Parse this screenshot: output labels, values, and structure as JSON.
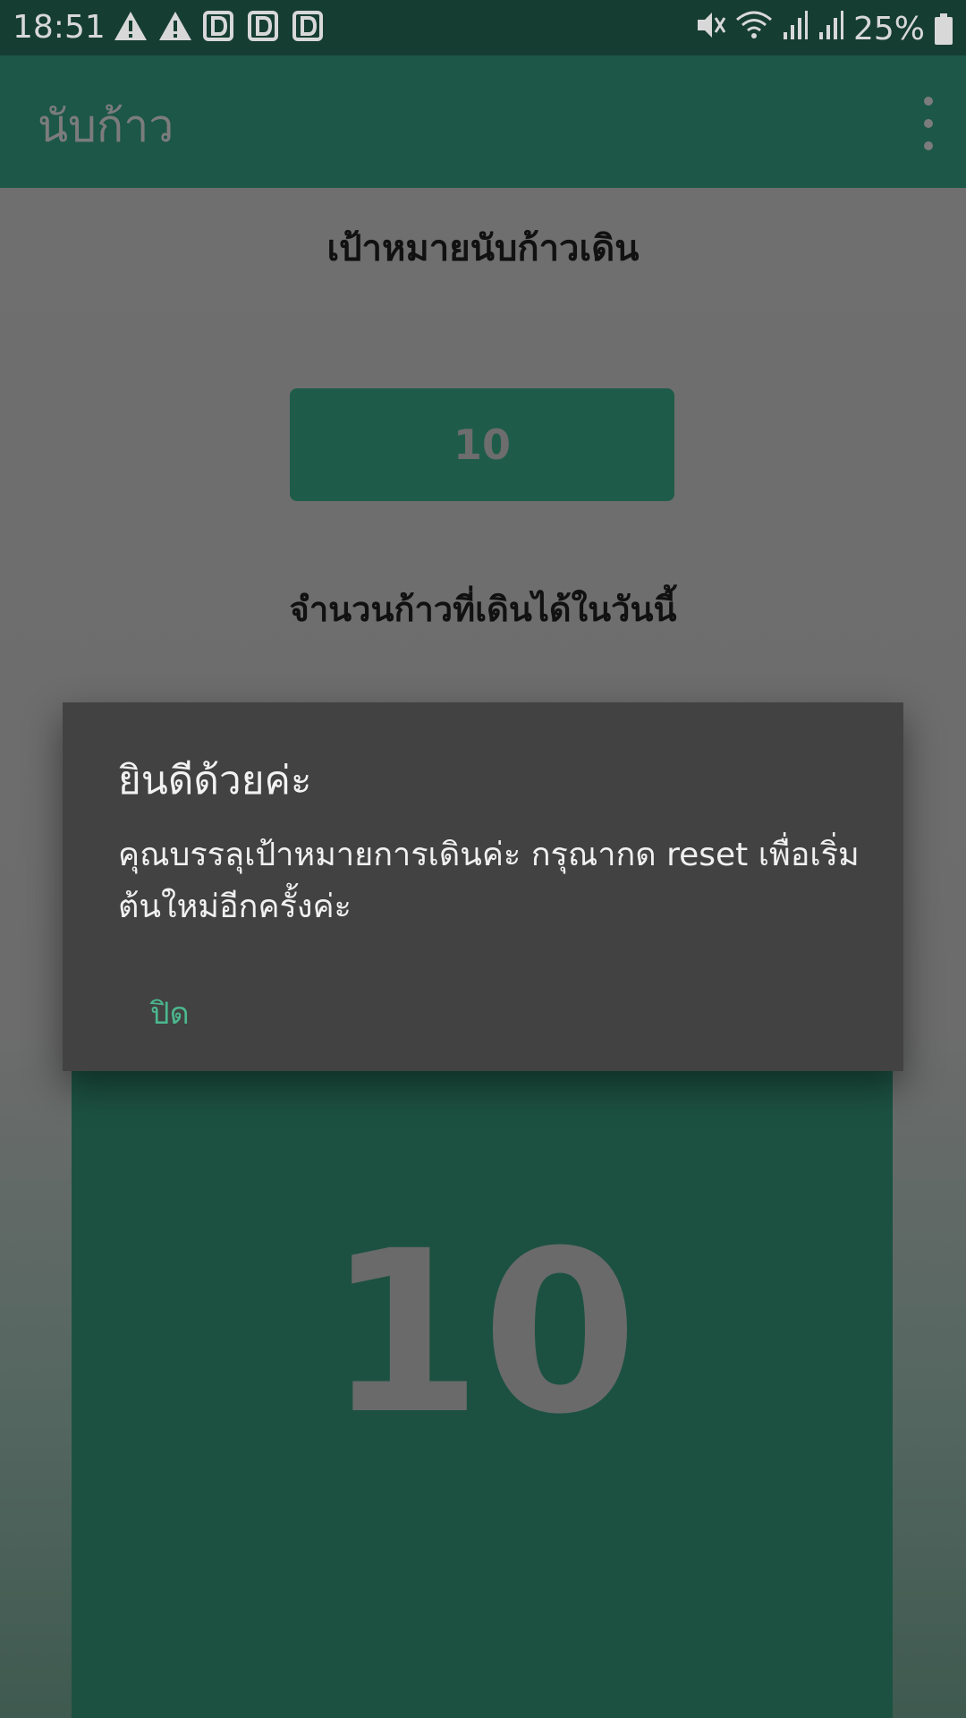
{
  "status_bar": {
    "time": "18:51",
    "battery": "25%"
  },
  "app_bar": {
    "title": "นับก้าว",
    "overflow_icon": "more-vert-icon"
  },
  "main": {
    "goal_label": "เป้าหมายนับก้าวเดิน",
    "goal_value": "10",
    "today_label": "จำนวนก้าวที่เดินได้ในวันนี้",
    "today_count": "10"
  },
  "dialog": {
    "title": "ยินดีด้วยค่ะ",
    "message": "คุณบรรลุเป้าหมายการเดินค่ะ กรุณากด reset เพื่อเริ่มต้นใหม่อีกครั้งค่ะ",
    "button_label": "ปิด"
  },
  "colors": {
    "status_bar": "#163d32",
    "app_bar": "#1c5748",
    "accent": "#4bb88f",
    "dialog_bg": "#424242"
  }
}
